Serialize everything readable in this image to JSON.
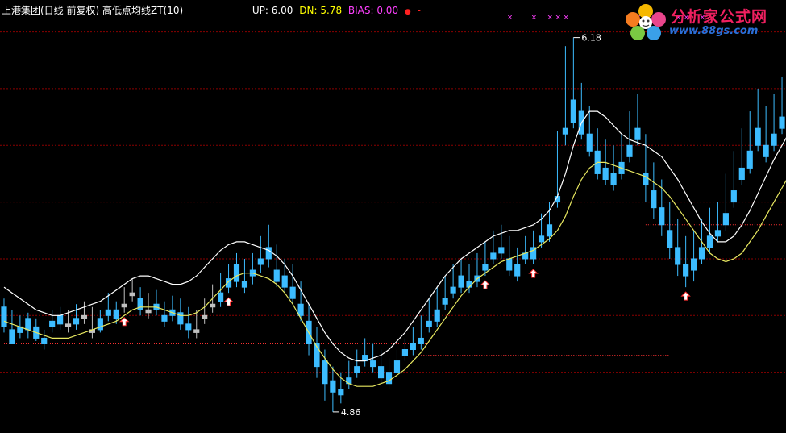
{
  "header": {
    "title": "上港集团(日线 前复权) 高低点均线ZT(10)",
    "up_label": "UP: 6.00",
    "dn_label": "DN: 5.78",
    "bias_label": "BIAS: 0.00",
    "bias_dot": "●",
    "bias_dash": "-"
  },
  "watermark": {
    "name": "分析家公式网",
    "url": "www.88gs.com"
  },
  "annotations": {
    "high": "6.18",
    "low": "4.86"
  },
  "colors": {
    "background": "#000000",
    "up": "#ff3232",
    "down": "#3cbcff",
    "flat": "#c0c0c0",
    "upper_line": "#ffffff",
    "lower_line": "#e8e860",
    "grid": "#8b0000",
    "magenta": "#ff40ff",
    "title": "#ffffff",
    "up_text": "#ffffff",
    "dn_text": "#ffff00",
    "bias_text": "#ff40ff"
  },
  "chart_data": {
    "type": "candlestick",
    "y_range": [
      4.8,
      6.25
    ],
    "highest": 6.18,
    "lowest": 4.86,
    "candles": [
      [
        5.23,
        5.26,
        5.16,
        5.14
      ],
      [
        5.15,
        5.22,
        5.1,
        5.13
      ],
      [
        5.16,
        5.2,
        5.14,
        5.12
      ],
      [
        5.19,
        5.21,
        5.15,
        5.12
      ],
      [
        5.16,
        5.19,
        5.12,
        5.11
      ],
      [
        5.12,
        5.15,
        5.1,
        5.08
      ],
      [
        5.18,
        5.22,
        5.16,
        5.14
      ],
      [
        5.2,
        5.23,
        5.17,
        5.15
      ],
      [
        5.17,
        5.22,
        5.16,
        5.14
      ],
      [
        5.19,
        5.24,
        5.17,
        5.15
      ],
      [
        5.2,
        5.25,
        5.19,
        5.17
      ],
      [
        5.15,
        5.23,
        5.14,
        5.12
      ],
      [
        5.19,
        5.22,
        5.15,
        5.14
      ],
      [
        5.22,
        5.28,
        5.2,
        5.18
      ],
      [
        5.22,
        5.25,
        5.19,
        5.17
      ],
      [
        5.24,
        5.3,
        5.23,
        5.21
      ],
      [
        5.28,
        5.33,
        5.27,
        5.25
      ],
      [
        5.26,
        5.3,
        5.22,
        5.2
      ],
      [
        5.22,
        5.28,
        5.21,
        5.19
      ],
      [
        5.24,
        5.29,
        5.22,
        5.2
      ],
      [
        5.2,
        5.25,
        5.18,
        5.16
      ],
      [
        5.22,
        5.27,
        5.2,
        5.18
      ],
      [
        5.21,
        5.26,
        5.17,
        5.15
      ],
      [
        5.17,
        5.23,
        5.15,
        5.12
      ],
      [
        5.15,
        5.22,
        5.14,
        5.12
      ],
      [
        5.2,
        5.26,
        5.19,
        5.17
      ],
      [
        5.24,
        5.31,
        5.23,
        5.21
      ],
      [
        5.28,
        5.35,
        5.25,
        5.23
      ],
      [
        5.33,
        5.38,
        5.3,
        5.28
      ],
      [
        5.38,
        5.42,
        5.32,
        5.3
      ],
      [
        5.32,
        5.4,
        5.3,
        5.28
      ],
      [
        5.36,
        5.42,
        5.34,
        5.31
      ],
      [
        5.4,
        5.48,
        5.38,
        5.35
      ],
      [
        5.44,
        5.52,
        5.4,
        5.37
      ],
      [
        5.36,
        5.45,
        5.32,
        5.3
      ],
      [
        5.34,
        5.4,
        5.3,
        5.28
      ],
      [
        5.3,
        5.38,
        5.26,
        5.24
      ],
      [
        5.24,
        5.32,
        5.2,
        5.18
      ],
      [
        5.18,
        5.24,
        5.1,
        5.06
      ],
      [
        5.1,
        5.16,
        5.02,
        4.98
      ],
      [
        5.04,
        5.08,
        4.96,
        4.9
      ],
      [
        4.97,
        5.02,
        4.93,
        4.86
      ],
      [
        4.94,
        5.0,
        4.92,
        4.89
      ],
      [
        4.98,
        5.04,
        4.96,
        4.94
      ],
      [
        5.02,
        5.08,
        5.0,
        4.98
      ],
      [
        5.06,
        5.12,
        5.04,
        5.02
      ],
      [
        5.04,
        5.1,
        5.02,
        5.0
      ],
      [
        5.02,
        5.08,
        4.98,
        4.96
      ],
      [
        5.0,
        5.05,
        4.96,
        4.94
      ],
      [
        5.04,
        5.08,
        5.0,
        4.98
      ],
      [
        5.08,
        5.12,
        5.06,
        5.04
      ],
      [
        5.1,
        5.16,
        5.08,
        5.06
      ],
      [
        5.12,
        5.2,
        5.1,
        5.08
      ],
      [
        5.18,
        5.26,
        5.16,
        5.14
      ],
      [
        5.22,
        5.3,
        5.18,
        5.16
      ],
      [
        5.26,
        5.34,
        5.24,
        5.22
      ],
      [
        5.3,
        5.38,
        5.28,
        5.26
      ],
      [
        5.34,
        5.4,
        5.3,
        5.28
      ],
      [
        5.32,
        5.38,
        5.3,
        5.28
      ],
      [
        5.34,
        5.42,
        5.32,
        5.3
      ],
      [
        5.38,
        5.46,
        5.36,
        5.34
      ],
      [
        5.42,
        5.5,
        5.4,
        5.38
      ],
      [
        5.44,
        5.52,
        5.42,
        5.4
      ],
      [
        5.4,
        5.48,
        5.36,
        5.34
      ],
      [
        5.38,
        5.44,
        5.34,
        5.32
      ],
      [
        5.42,
        5.48,
        5.4,
        5.38
      ],
      [
        5.44,
        5.5,
        5.4,
        5.38
      ],
      [
        5.48,
        5.56,
        5.46,
        5.44
      ],
      [
        5.52,
        5.6,
        5.48,
        5.46
      ],
      [
        5.62,
        5.85,
        5.6,
        5.58
      ],
      [
        5.86,
        6.15,
        5.84,
        5.8
      ],
      [
        5.96,
        6.18,
        5.88,
        5.86
      ],
      [
        5.92,
        6.02,
        5.84,
        5.82
      ],
      [
        5.84,
        5.94,
        5.78,
        5.76
      ],
      [
        5.78,
        5.86,
        5.7,
        5.68
      ],
      [
        5.72,
        5.82,
        5.68,
        5.66
      ],
      [
        5.7,
        5.8,
        5.66,
        5.64
      ],
      [
        5.74,
        5.84,
        5.7,
        5.68
      ],
      [
        5.8,
        5.92,
        5.76,
        5.74
      ],
      [
        5.86,
        5.98,
        5.82,
        5.8
      ],
      [
        5.7,
        5.84,
        5.66,
        5.6
      ],
      [
        5.64,
        5.74,
        5.58,
        5.54
      ],
      [
        5.58,
        5.68,
        5.52,
        5.48
      ],
      [
        5.5,
        5.6,
        5.44,
        5.4
      ],
      [
        5.44,
        5.54,
        5.38,
        5.34
      ],
      [
        5.38,
        5.48,
        5.34,
        5.3
      ],
      [
        5.4,
        5.5,
        5.36,
        5.32
      ],
      [
        5.44,
        5.54,
        5.4,
        5.38
      ],
      [
        5.48,
        5.58,
        5.44,
        5.42
      ],
      [
        5.5,
        5.6,
        5.48,
        5.46
      ],
      [
        5.56,
        5.7,
        5.52,
        5.5
      ],
      [
        5.64,
        5.78,
        5.6,
        5.58
      ],
      [
        5.72,
        5.86,
        5.68,
        5.66
      ],
      [
        5.78,
        5.92,
        5.72,
        5.7
      ],
      [
        5.86,
        6.0,
        5.8,
        5.78
      ],
      [
        5.8,
        5.94,
        5.76,
        5.74
      ],
      [
        5.84,
        5.98,
        5.8,
        5.78
      ],
      [
        5.9,
        6.04,
        5.86,
        5.84
      ]
    ],
    "upper_line": [
      5.3,
      5.28,
      5.26,
      5.24,
      5.22,
      5.21,
      5.2,
      5.2,
      5.21,
      5.22,
      5.23,
      5.24,
      5.25,
      5.27,
      5.29,
      5.31,
      5.33,
      5.34,
      5.34,
      5.33,
      5.32,
      5.31,
      5.31,
      5.32,
      5.34,
      5.37,
      5.4,
      5.43,
      5.45,
      5.46,
      5.46,
      5.45,
      5.44,
      5.43,
      5.41,
      5.38,
      5.34,
      5.29,
      5.24,
      5.19,
      5.14,
      5.1,
      5.07,
      5.05,
      5.04,
      5.04,
      5.05,
      5.06,
      5.08,
      5.11,
      5.14,
      5.18,
      5.22,
      5.26,
      5.3,
      5.34,
      5.37,
      5.4,
      5.42,
      5.44,
      5.46,
      5.48,
      5.49,
      5.5,
      5.5,
      5.51,
      5.52,
      5.54,
      5.57,
      5.62,
      5.7,
      5.8,
      5.88,
      5.92,
      5.92,
      5.9,
      5.87,
      5.84,
      5.82,
      5.81,
      5.8,
      5.78,
      5.76,
      5.72,
      5.68,
      5.63,
      5.58,
      5.53,
      5.49,
      5.46,
      5.46,
      5.48,
      5.52,
      5.57,
      5.63,
      5.69,
      5.75,
      5.8,
      5.85,
      5.9
    ],
    "lower_line": [
      5.18,
      5.17,
      5.16,
      5.15,
      5.14,
      5.13,
      5.12,
      5.12,
      5.12,
      5.13,
      5.14,
      5.15,
      5.16,
      5.17,
      5.18,
      5.2,
      5.22,
      5.23,
      5.23,
      5.23,
      5.22,
      5.21,
      5.2,
      5.2,
      5.21,
      5.23,
      5.26,
      5.29,
      5.32,
      5.34,
      5.35,
      5.35,
      5.34,
      5.33,
      5.31,
      5.28,
      5.24,
      5.19,
      5.14,
      5.09,
      5.05,
      5.01,
      4.98,
      4.96,
      4.95,
      4.95,
      4.95,
      4.96,
      4.97,
      4.99,
      5.01,
      5.04,
      5.07,
      5.11,
      5.15,
      5.19,
      5.23,
      5.27,
      5.3,
      5.33,
      5.35,
      5.37,
      5.39,
      5.4,
      5.41,
      5.42,
      5.43,
      5.45,
      5.47,
      5.5,
      5.55,
      5.62,
      5.68,
      5.72,
      5.74,
      5.74,
      5.73,
      5.72,
      5.71,
      5.7,
      5.69,
      5.67,
      5.65,
      5.62,
      5.58,
      5.54,
      5.5,
      5.46,
      5.42,
      5.4,
      5.39,
      5.4,
      5.42,
      5.46,
      5.5,
      5.55,
      5.6,
      5.65,
      5.7,
      5.75
    ],
    "support_lines": [
      {
        "y": 5.1,
        "from": 0,
        "to": 53
      },
      {
        "y": 5.06,
        "from": 52,
        "to": 83
      },
      {
        "y": 5.52,
        "from": 80,
        "to": 109
      }
    ],
    "buy_arrows": [
      15,
      28,
      60,
      66,
      85,
      108,
      112
    ],
    "top_markers": [
      63,
      66,
      68,
      69,
      70,
      79,
      80,
      84,
      85,
      87
    ]
  }
}
